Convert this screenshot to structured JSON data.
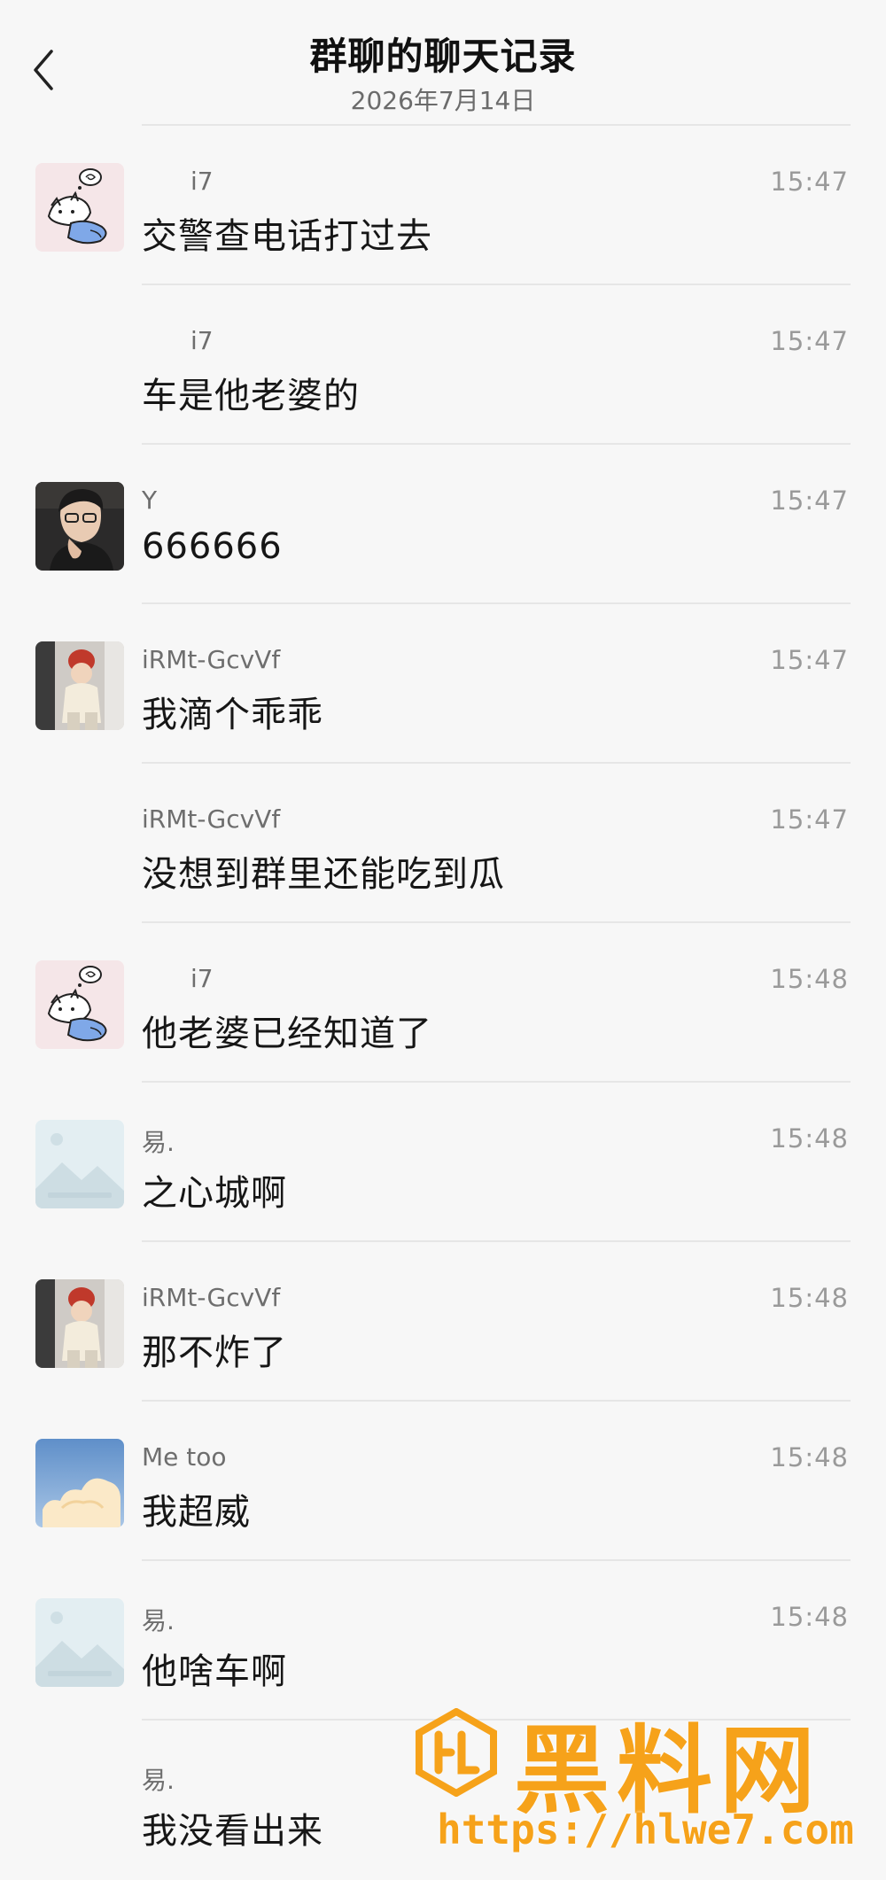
{
  "header": {
    "title": "群聊的聊天记录",
    "date": "2026年7月14日"
  },
  "messages": [
    {
      "sender": "i7",
      "time": "15:47",
      "text": "交警查电话打过去",
      "avatar": "i7-cat-sticker-avatar"
    },
    {
      "sender": "i7",
      "time": "15:47",
      "text": "车是他老婆的",
      "avatar": ""
    },
    {
      "sender": "Y",
      "time": "15:47",
      "text": "666666",
      "avatar": "y-portrait-avatar"
    },
    {
      "sender": "iRMt-GcvVf",
      "time": "15:47",
      "text": "我滴个乖乖",
      "avatar": "red-hat-child-avatar"
    },
    {
      "sender": "iRMt-GcvVf",
      "time": "15:47",
      "text": "没想到群里还能吃到瓜",
      "avatar": ""
    },
    {
      "sender": "i7",
      "time": "15:48",
      "text": "他老婆已经知道了",
      "avatar": "i7-cat-sticker-avatar"
    },
    {
      "sender": "易.",
      "time": "15:48",
      "text": "之心城啊",
      "avatar": "placeholder-landscape-avatar"
    },
    {
      "sender": "iRMt-GcvVf",
      "time": "15:48",
      "text": "那不炸了",
      "avatar": "red-hat-child-avatar"
    },
    {
      "sender": "Me too",
      "time": "15:48",
      "text": "我超威",
      "avatar": "sky-clouds-avatar"
    },
    {
      "sender": "易.",
      "time": "15:48",
      "text": "他啥车啊",
      "avatar": "placeholder-landscape-avatar"
    },
    {
      "sender": "易.",
      "time": "",
      "text": "我没看出来",
      "avatar": ""
    }
  ],
  "watermark": {
    "title": "黑料网",
    "url": "https://hlwe7.com"
  },
  "colors": {
    "background": "#f7f7f7",
    "watermark": "#f6a21a",
    "divider": "#e6e6e6"
  }
}
